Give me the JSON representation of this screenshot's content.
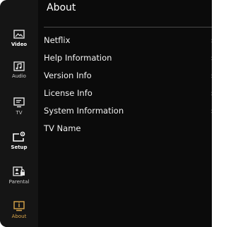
{
  "page": {
    "title": "About"
  },
  "sidebar": {
    "items": [
      {
        "label": "Video",
        "icon": "video-icon"
      },
      {
        "label": "Audio",
        "icon": "audio-icon"
      },
      {
        "label": "TV",
        "icon": "tv-icon"
      },
      {
        "label": "Setup",
        "icon": "setup-icon"
      },
      {
        "label": "Parental",
        "icon": "parental-lock-icon"
      },
      {
        "label": "About",
        "icon": "about-info-icon"
      }
    ],
    "active": "About"
  },
  "menu": {
    "items": [
      {
        "label": "Netflix",
        "chevron": "›"
      },
      {
        "label": "Help Information",
        "chevron": "›"
      },
      {
        "label": "Version Info",
        "chevron": "›"
      },
      {
        "label": "License Info",
        "chevron": "›"
      },
      {
        "label": "System Information",
        "chevron": "›"
      },
      {
        "label": "TV Name",
        "chevron": ""
      }
    ]
  },
  "colors": {
    "background": "#0b0b0b",
    "sidebar": "#151515",
    "accent_active": "#d9a54a",
    "text": "#f2f2f2"
  }
}
